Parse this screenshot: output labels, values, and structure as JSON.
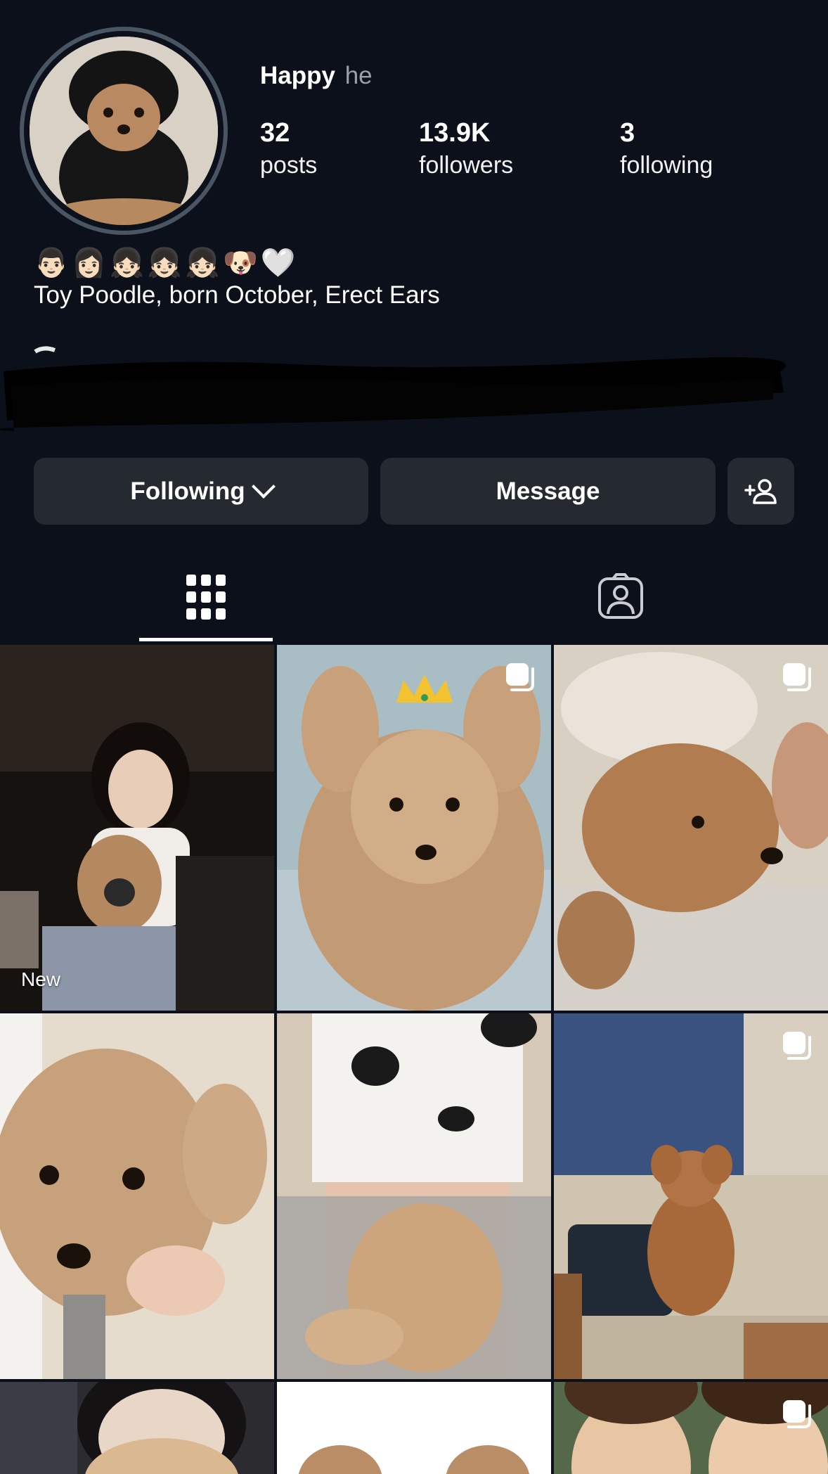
{
  "profile": {
    "name": "Happy",
    "subname": "he",
    "stats": [
      {
        "value": "32",
        "label": "posts"
      },
      {
        "value": "13.9K",
        "label": "followers"
      },
      {
        "value": "3",
        "label": "following"
      }
    ],
    "emoji_line": "👨🏻👩🏻👧🏻👧🏻👧🏻🐶🤍",
    "bio": "Toy Poodle, born October, Erect Ears"
  },
  "actions": {
    "following_label": "Following",
    "message_label": "Message",
    "add_user_icon": "add-person-icon"
  },
  "tabs": [
    {
      "icon": "grid-icon",
      "active": true
    },
    {
      "icon": "tagged-icon",
      "active": false
    }
  ],
  "posts": [
    {
      "badge": "New",
      "multi": false,
      "colors": [
        "#1a1410",
        "#3a2e26",
        "#b48a66"
      ]
    },
    {
      "badge": "",
      "multi": true,
      "colors": [
        "#9fb3bb",
        "#c9a47e",
        "#8b6a4f"
      ]
    },
    {
      "badge": "",
      "multi": true,
      "colors": [
        "#d9cfc2",
        "#b98a60",
        "#a67a55"
      ]
    },
    {
      "badge": "",
      "multi": false,
      "colors": [
        "#e8dccb",
        "#c49b72",
        "#8a6a4c"
      ]
    },
    {
      "badge": "",
      "multi": false,
      "colors": [
        "#f3f1ee",
        "#b7b2ab",
        "#d4b08a"
      ]
    },
    {
      "badge": "",
      "multi": true,
      "colors": [
        "#3d4f74",
        "#c8bda9",
        "#9c6a3c"
      ]
    },
    {
      "badge": "",
      "multi": false,
      "colors": [
        "#2a2a2e",
        "#e9d9c9",
        "#c49a72"
      ]
    },
    {
      "badge": "",
      "multi": false,
      "colors": [
        "#ffffff",
        "#ffffff",
        "#b98d66"
      ]
    },
    {
      "badge": "",
      "multi": true,
      "colors": [
        "#4d5e3e",
        "#e6c8a8",
        "#6b4a32"
      ]
    }
  ]
}
